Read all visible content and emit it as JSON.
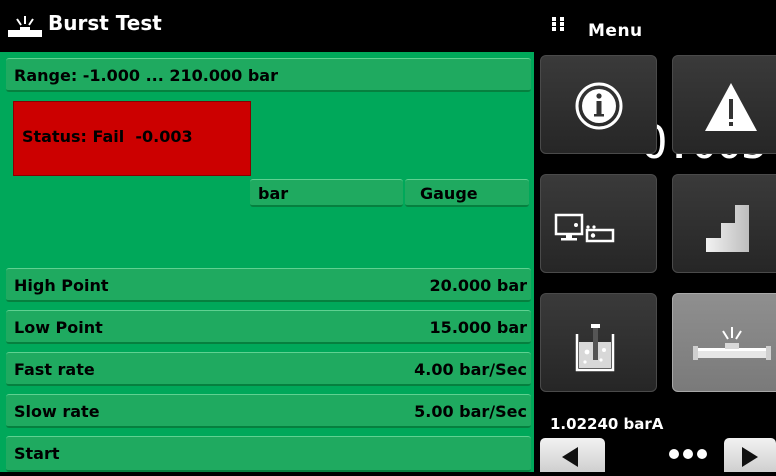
{
  "title_bar": {
    "title": "Burst Test",
    "icon": "burst-test-icon"
  },
  "menu_header": {
    "label": "Menu",
    "icon": "grid-dots-icon"
  },
  "range": {
    "label": "Range:  -1.000 ... 210.000 bar"
  },
  "status": {
    "label": "Status: Fail",
    "value": "-0.003",
    "color": "#cc0000"
  },
  "reading": {
    "value": "-0.005",
    "unit": "bar",
    "mode": "Gauge"
  },
  "rows": [
    {
      "label": "High Point",
      "value": "20.000 bar"
    },
    {
      "label": "Low Point",
      "value": "15.000 bar"
    },
    {
      "label": "Fast rate",
      "value": "4.00 bar/Sec"
    },
    {
      "label": "Slow rate",
      "value": "5.00 bar/Sec"
    },
    {
      "label": "Start",
      "value": ""
    }
  ],
  "menu_tiles": [
    {
      "icon": "info-icon"
    },
    {
      "icon": "warning-icon"
    },
    {
      "icon": "remote-connection-icon"
    },
    {
      "icon": "step-program-icon"
    },
    {
      "icon": "leak-test-icon"
    },
    {
      "icon": "burst-test-icon",
      "selected": true
    }
  ],
  "barometer": {
    "value": "1.02240 barA"
  },
  "pager": {
    "prev_icon": "left-arrow-icon",
    "next_icon": "right-arrow-icon",
    "indicator_icon": "page-dots-icon"
  },
  "colors": {
    "panel_green": "#00a85a",
    "fail_red": "#cc0000",
    "background": "#000000"
  }
}
